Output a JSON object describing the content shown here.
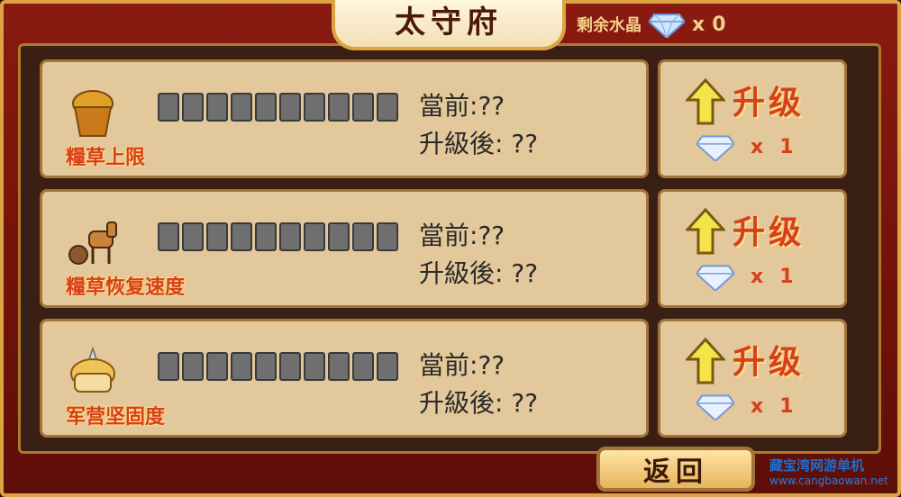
{
  "title": "太守府",
  "crystal": {
    "label": "剩余水晶",
    "times": "x",
    "count": "0",
    "icon": "diamond-icon"
  },
  "rows": [
    {
      "label": "糧草上限",
      "icon": "grain-basket-icon",
      "current_label": "當前:",
      "current_value": "??",
      "next_label": "升級後:",
      "next_value": "??",
      "bar_segments": 10,
      "progress": 0
    },
    {
      "label": "糧草恢复速度",
      "icon": "horse-cart-icon",
      "current_label": "當前:",
      "current_value": "??",
      "next_label": "升級後:",
      "next_value": "??",
      "bar_segments": 10,
      "progress": 0
    },
    {
      "label": "军营坚固度",
      "icon": "camp-tent-icon",
      "current_label": "當前:",
      "current_value": "??",
      "next_label": "升級後:",
      "next_value": "??",
      "bar_segments": 10,
      "progress": 0
    }
  ],
  "upgrade": {
    "label": "升级",
    "cost_times": "x",
    "cost_value": "1"
  },
  "back_button": {
    "label": "返回"
  },
  "watermark": {
    "line1": "藏宝湾网游单机",
    "line2": "www.cangbaowan.net"
  },
  "colors": {
    "label_red": "#d6401a",
    "panel": "#e2c89a",
    "frame": "#8a1a10",
    "gold": "#d9a441"
  }
}
